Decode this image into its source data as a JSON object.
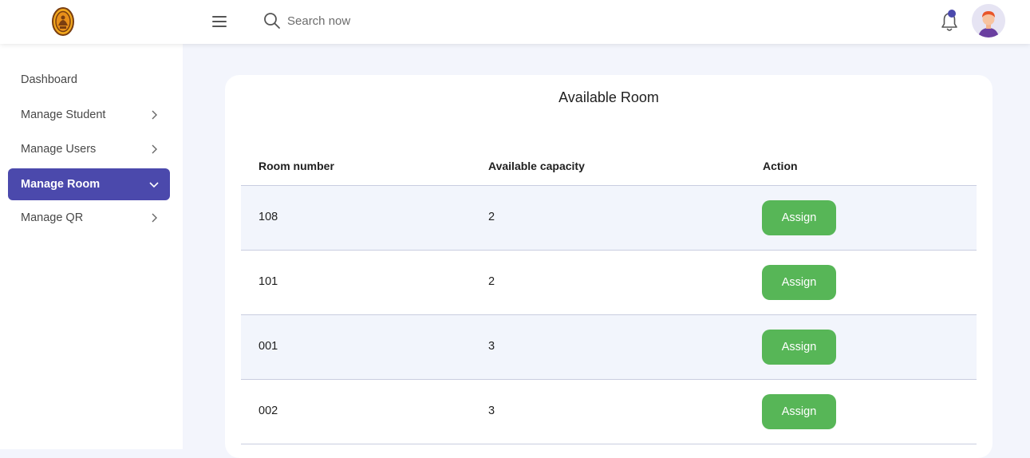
{
  "header": {
    "search_placeholder": "Search now",
    "accent_color": "#4b49ac"
  },
  "sidebar": {
    "items": [
      {
        "label": "Dashboard",
        "icon": null
      },
      {
        "label": "Manage Student",
        "icon": "chevron-right-icon"
      },
      {
        "label": "Manage Users",
        "icon": "chevron-right-icon"
      },
      {
        "label": "Manage Room",
        "icon": "chevron-down-icon",
        "active": true
      },
      {
        "label": "Manage QR",
        "icon": "chevron-right-icon"
      }
    ]
  },
  "main": {
    "title": "Available Room",
    "columns": [
      "Room number",
      "Available capacity",
      "Action"
    ],
    "rows": [
      {
        "room": "108",
        "capacity": "2",
        "action": "Assign"
      },
      {
        "room": "101",
        "capacity": "2",
        "action": "Assign"
      },
      {
        "room": "001",
        "capacity": "3",
        "action": "Assign"
      },
      {
        "room": "002",
        "capacity": "3",
        "action": "Assign"
      }
    ],
    "action_color": "#57b657"
  }
}
